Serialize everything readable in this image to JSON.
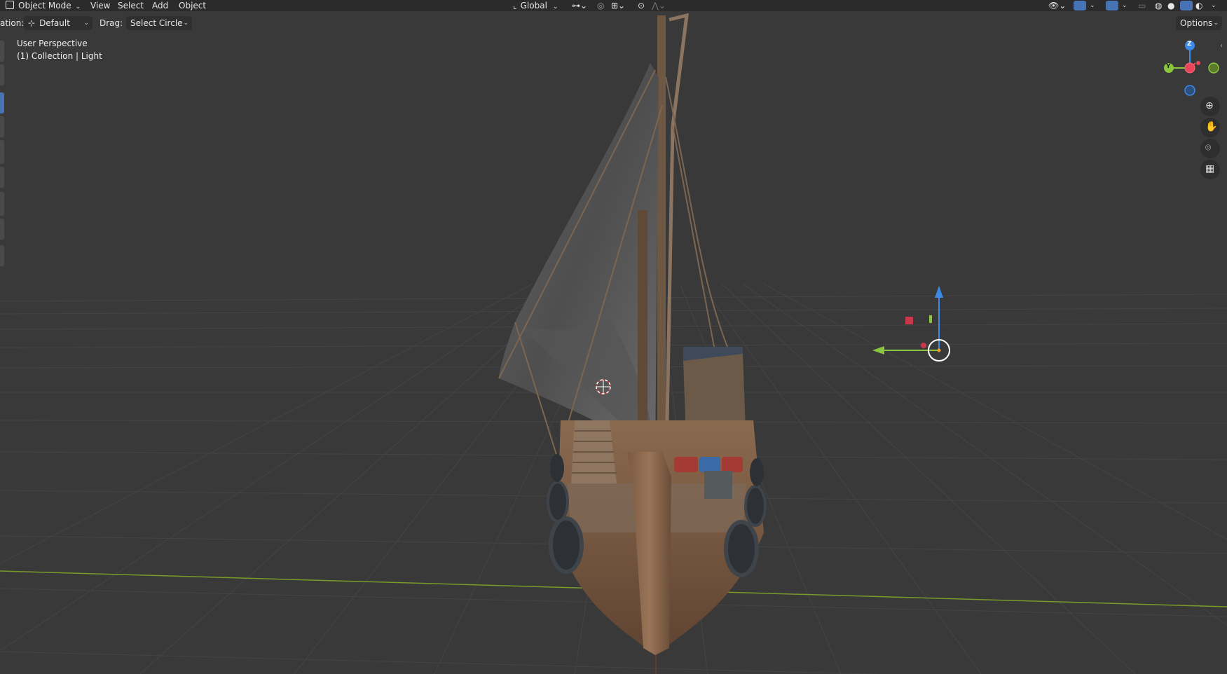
{
  "header": {
    "mode_label": "Object Mode",
    "menu": [
      "View",
      "Select",
      "Add",
      "Object"
    ],
    "transform_orientation": "Global"
  },
  "toolbar": {
    "orientation_label": "ation:",
    "orientation_value": "Default",
    "drag_label": "Drag:",
    "drag_value": "Select Circle",
    "options_label": "Options"
  },
  "viewport": {
    "view_name": "User Perspective",
    "collection_info": "(1) Collection | Light"
  },
  "gizmo": {
    "axes": [
      "Z",
      "Y"
    ],
    "colors": {
      "x": "#e8475b",
      "y": "#8bc53f",
      "z": "#3b8be6"
    }
  },
  "nav_icons": [
    "zoom-icon",
    "hand-pan-icon",
    "camera-icon",
    "grid-view-icon"
  ],
  "colors": {
    "background": "#393939",
    "header": "#2b2b2b",
    "grid": "#444444",
    "x_axis_line": "#7a9a2a",
    "accent": "#4772b3"
  }
}
